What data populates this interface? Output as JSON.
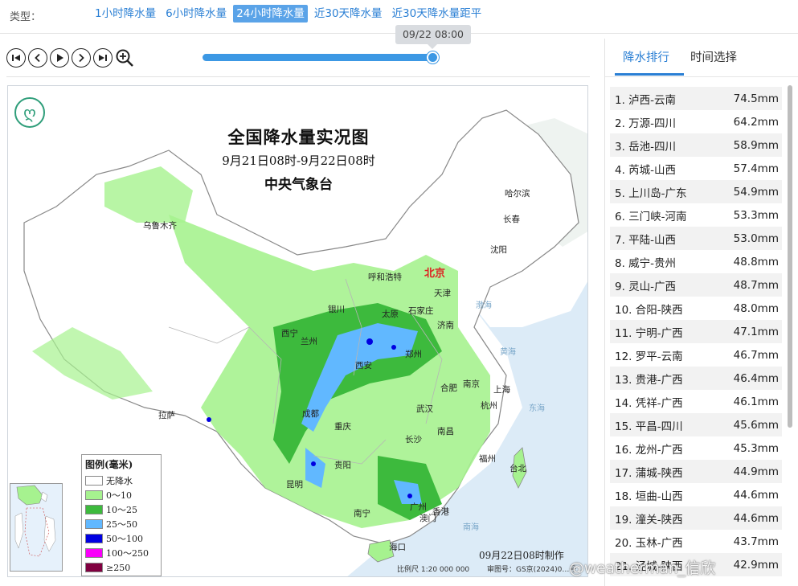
{
  "type_bar": {
    "label": "类型：",
    "tabs": [
      {
        "label": "1小时降水量",
        "active": false
      },
      {
        "label": "6小时降水量",
        "active": false
      },
      {
        "label": "24小时降水量",
        "active": true
      },
      {
        "label": "近30天降水量",
        "active": false
      },
      {
        "label": "近30天降水量距平",
        "active": false
      }
    ]
  },
  "player": {
    "controls": [
      "first-icon",
      "prev-icon",
      "play-icon",
      "next-icon",
      "last-icon",
      "zoom-in-icon"
    ],
    "current_time": "09/22 08:00",
    "progress_percent": 100
  },
  "map": {
    "title": "全国降水量实况图",
    "period": "9月21日08时-9月22日08时",
    "issuer": "中央气象台",
    "capital": "北京",
    "cities": [
      "乌鲁木齐",
      "哈尔滨",
      "长春",
      "沈阳",
      "呼和浩特",
      "天津",
      "银川",
      "太原",
      "石家庄",
      "西宁",
      "兰州",
      "济南",
      "郑州",
      "西安",
      "南京",
      "合肥",
      "上海",
      "杭州",
      "成都",
      "武汉",
      "拉萨",
      "重庆",
      "长沙",
      "南昌",
      "福州",
      "贵阳",
      "台北",
      "昆明",
      "南宁",
      "广州",
      "香港",
      "澳门",
      "海口"
    ],
    "seas": [
      "渤海",
      "黄海",
      "东海",
      "南海"
    ],
    "legend": {
      "title": "图例(毫米)",
      "items": [
        {
          "label": "无降水",
          "color": "#ffffff"
        },
        {
          "label": "0～10",
          "color": "#a6f28f"
        },
        {
          "label": "10～25",
          "color": "#3dba3d"
        },
        {
          "label": "25～50",
          "color": "#61b8ff"
        },
        {
          "label": "50～100",
          "color": "#0000e1"
        },
        {
          "label": "100～250",
          "color": "#fa00fa"
        },
        {
          "label": "≥250",
          "color": "#800040"
        }
      ]
    },
    "made_note": "09月22日08时制作",
    "scale_note": "比例尺 1:20 000 000",
    "review_note": "审图号：GS京(2024)0…号"
  },
  "watermark": "@weatherman_信欣",
  "ranking": {
    "tabs": [
      {
        "label": "降水排行",
        "active": true
      },
      {
        "label": "时间选择",
        "active": false
      }
    ],
    "items": [
      {
        "name": "1. 泸西-云南",
        "value": "74.5mm"
      },
      {
        "name": "2. 万源-四川",
        "value": "64.2mm"
      },
      {
        "name": "3. 岳池-四川",
        "value": "58.9mm"
      },
      {
        "name": "4. 芮城-山西",
        "value": "57.4mm"
      },
      {
        "name": "5. 上川岛-广东",
        "value": "54.9mm"
      },
      {
        "name": "6. 三门峡-河南",
        "value": "53.3mm"
      },
      {
        "name": "7. 平陆-山西",
        "value": "53.0mm"
      },
      {
        "name": "8. 威宁-贵州",
        "value": "48.8mm"
      },
      {
        "name": "9. 灵山-广西",
        "value": "48.7mm"
      },
      {
        "name": "10. 合阳-陕西",
        "value": "48.0mm"
      },
      {
        "name": "11. 宁明-广西",
        "value": "47.1mm"
      },
      {
        "name": "12. 罗平-云南",
        "value": "46.7mm"
      },
      {
        "name": "13. 贵港-广西",
        "value": "46.4mm"
      },
      {
        "name": "14. 凭祥-广西",
        "value": "46.1mm"
      },
      {
        "name": "15. 平昌-四川",
        "value": "45.6mm"
      },
      {
        "name": "16. 龙州-广西",
        "value": "45.3mm"
      },
      {
        "name": "17. 蒲城-陕西",
        "value": "44.9mm"
      },
      {
        "name": "18. 垣曲-山西",
        "value": "44.6mm"
      },
      {
        "name": "19. 潼关-陕西",
        "value": "44.6mm"
      },
      {
        "name": "20. 玉林-广西",
        "value": "43.7mm"
      },
      {
        "name": "21. 泾城-陕西",
        "value": "42.9mm"
      }
    ]
  }
}
